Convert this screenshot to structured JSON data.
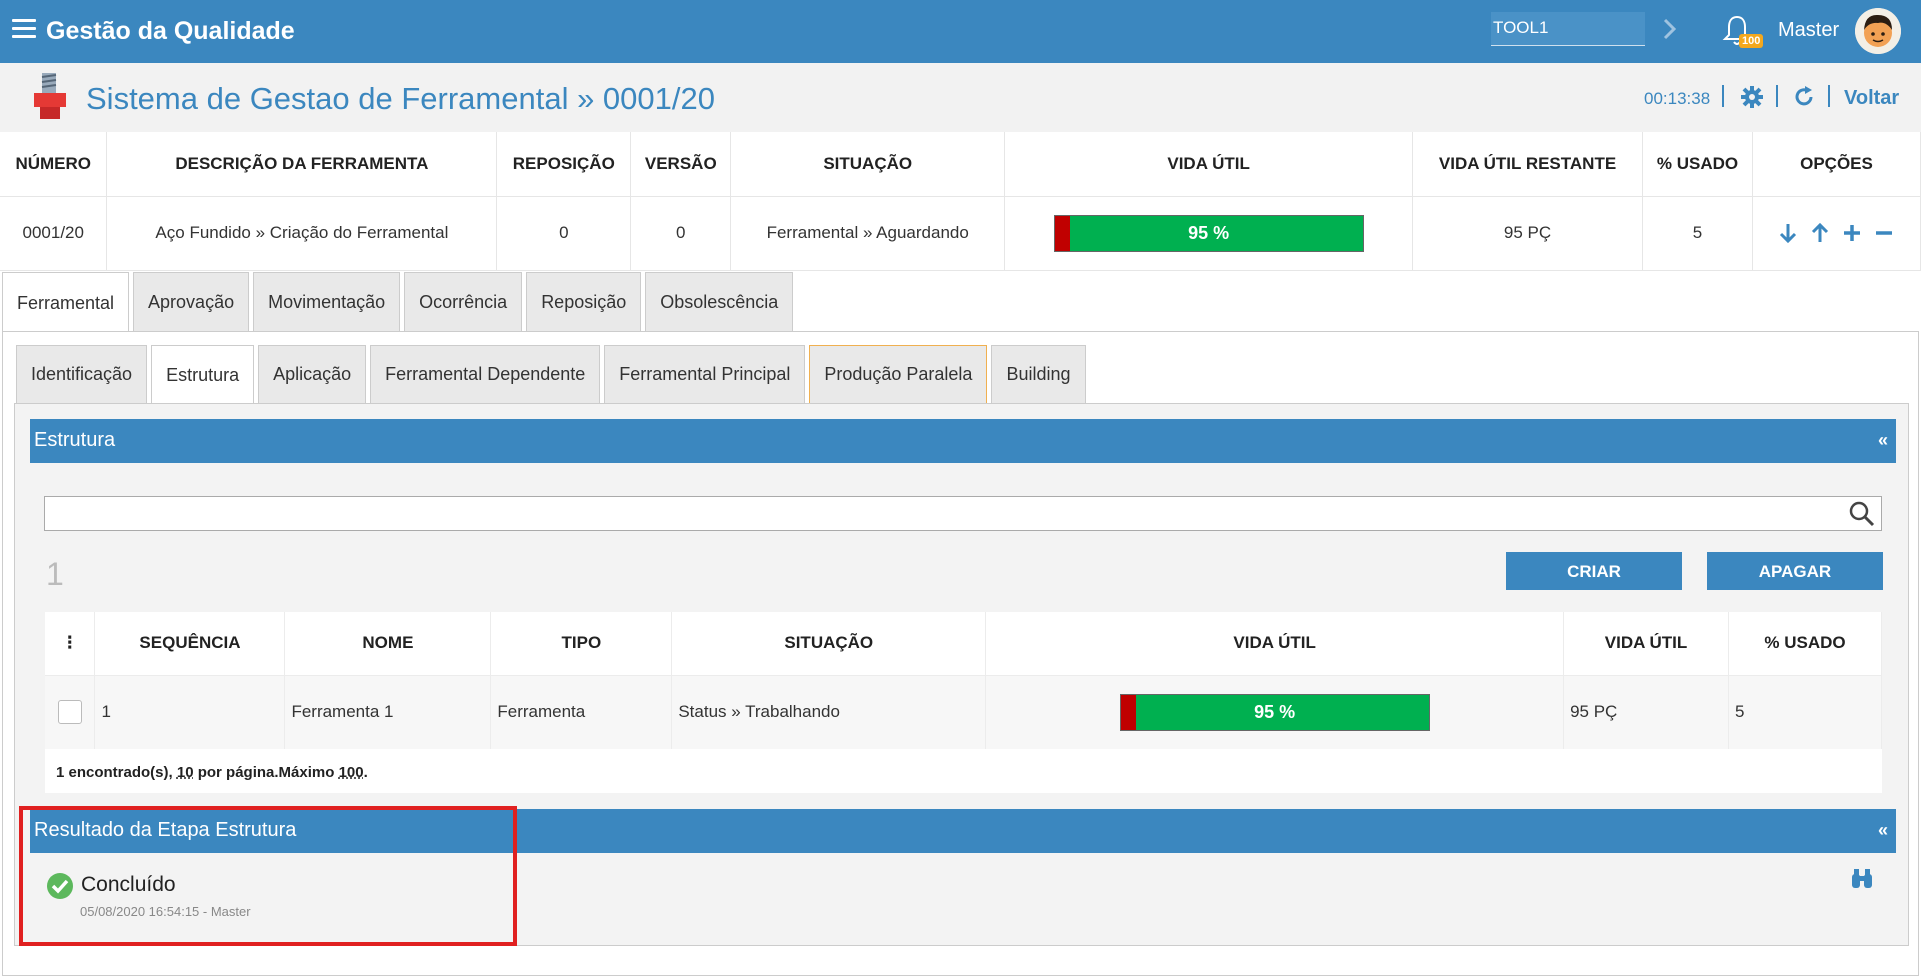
{
  "topbar": {
    "app_title": "Gestão da Qualidade",
    "search_value": "TOOL1",
    "notification_count": "100",
    "user_name": "Master"
  },
  "header": {
    "page_title": "Sistema de Gestao de Ferramental » 0001/20",
    "clock": "00:13:38",
    "back_label": "Voltar"
  },
  "summary": {
    "headers": [
      "NÚMERO",
      "DESCRIÇÃO DA FERRAMENTA",
      "REPOSIÇÃO",
      "VERSÃO",
      "SITUAÇÃO",
      "VIDA ÚTIL",
      "VIDA ÚTIL RESTANTE",
      "% USADO",
      "OPÇÕES"
    ],
    "row": {
      "numero": "0001/20",
      "descricao": "Aço Fundido » Criação do Ferramental",
      "reposicao": "0",
      "versao": "0",
      "situacao": "Ferramental » Aguardando",
      "vida_util_label": "95 %",
      "vida_util_pct": 95,
      "vida_restante": "95 PÇ",
      "usado": "5"
    }
  },
  "outer_tabs": [
    "Ferramental",
    "Aprovação",
    "Movimentação",
    "Ocorrência",
    "Reposição",
    "Obsolescência"
  ],
  "inner_tabs": [
    "Identificação",
    "Estrutura",
    "Aplicação",
    "Ferramental Dependente",
    "Ferramental Principal",
    "Produção Paralela",
    "Building"
  ],
  "estrutura": {
    "title": "Estrutura",
    "collapse_symbol": "«",
    "count": "1",
    "create_label": "CRIAR",
    "delete_label": "APAGAR",
    "grid_menu_symbol": "⋮",
    "columns": [
      "SEQUÊNCIA",
      "NOME",
      "TIPO",
      "SITUAÇÃO",
      "VIDA ÚTIL",
      "VIDA ÚTIL",
      "% USADO"
    ],
    "row": {
      "sequencia": "1",
      "nome": "Ferramenta 1",
      "tipo": "Ferramenta",
      "situacao": "Status » Trabalhando",
      "vida_util_label": "95 %",
      "vida_util_pct": 95,
      "vida_util_restante": "95 PÇ",
      "usado": "5"
    },
    "footer": {
      "found": "1 encontrado(s), ",
      "per_page": "10",
      "per_page_text": " por página.Máximo ",
      "max": "100",
      "end": "."
    }
  },
  "resultado": {
    "title": "Resultado da Etapa Estrutura",
    "collapse_symbol": "«",
    "status": "Concluído",
    "meta": "05/08/2020 16:54:15 - Master"
  },
  "colors": {
    "primary": "#3b87bf",
    "bar_green": "#00b050",
    "bar_red": "#c00000",
    "highlight": "#e02020",
    "badge": "#f4a81d"
  }
}
